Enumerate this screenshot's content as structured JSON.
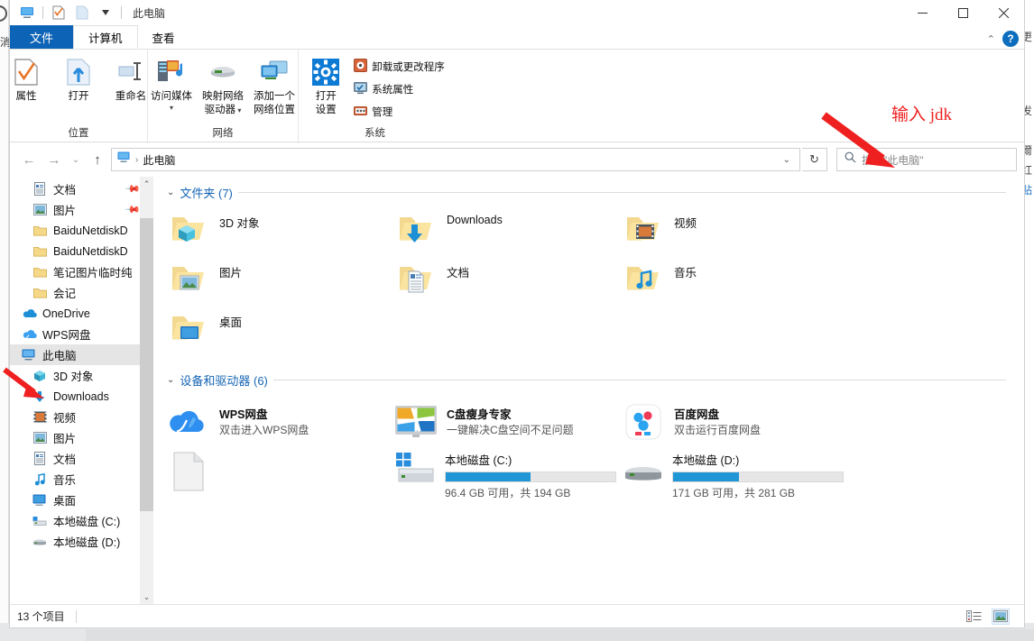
{
  "window": {
    "title": "此电脑",
    "quick_access": [
      "computer-icon",
      "properties-icon",
      "new-folder-icon",
      "dropdown-caret-icon"
    ],
    "controls": {
      "minimize": "—",
      "maximize": "□",
      "close": "✕"
    }
  },
  "tabs": [
    {
      "label": "文件",
      "kind": "file"
    },
    {
      "label": "计算机",
      "kind": "active"
    },
    {
      "label": "查看",
      "kind": "normal"
    }
  ],
  "tab_right": {
    "collapse": "⌃",
    "help": "?"
  },
  "ribbon": {
    "groups": [
      {
        "label": "位置",
        "big_buttons": [
          {
            "label": "属性",
            "icon": "properties-icon"
          },
          {
            "label": "打开",
            "icon": "open-icon"
          },
          {
            "label": "重命名",
            "icon": "rename-icon"
          }
        ],
        "small_buttons": []
      },
      {
        "label": "网络",
        "big_buttons": [
          {
            "label": "访问媒体",
            "label2": "",
            "icon": "media-server-icon",
            "has_caret": true
          },
          {
            "label": "映射网络",
            "label2": "驱动器",
            "icon": "map-drive-icon",
            "has_caret": true
          },
          {
            "label": "添加一个",
            "label2": "网络位置",
            "icon": "add-network-icon",
            "has_caret": false
          }
        ],
        "small_buttons": []
      },
      {
        "label": "系统",
        "big_buttons": [
          {
            "label": "打开",
            "label2": "设置",
            "icon": "settings-gear-icon"
          }
        ],
        "small_buttons": [
          {
            "label": "卸载或更改程序",
            "icon": "uninstall-icon"
          },
          {
            "label": "系统属性",
            "icon": "system-properties-icon"
          },
          {
            "label": "管理",
            "icon": "manage-icon"
          }
        ]
      }
    ]
  },
  "addressbar": {
    "back": "←",
    "forward": "→",
    "history": "⌄",
    "up": "↑",
    "breadcrumb_icon": "computer-icon",
    "breadcrumb": "此电脑",
    "breadcrumb_sep": "›",
    "dropdown": "⌄",
    "refresh": "↻"
  },
  "search": {
    "placeholder": "搜索\"此电脑\"",
    "icon": "search-icon"
  },
  "sidebar": {
    "items": [
      {
        "label": "文档",
        "icon": "documents-icon",
        "indent": 1,
        "pinned": true,
        "selected": false
      },
      {
        "label": "图片",
        "icon": "pictures-icon",
        "indent": 1,
        "pinned": true,
        "selected": false
      },
      {
        "label": "BaiduNetdiskD",
        "icon": "folder-icon",
        "indent": 1,
        "pinned": false,
        "selected": false
      },
      {
        "label": "BaiduNetdiskD",
        "icon": "folder-icon",
        "indent": 1,
        "pinned": false,
        "selected": false
      },
      {
        "label": "笔记图片临时纯",
        "icon": "folder-icon",
        "indent": 1,
        "pinned": false,
        "selected": false
      },
      {
        "label": "会记",
        "icon": "folder-icon",
        "indent": 1,
        "pinned": false,
        "selected": false
      },
      {
        "label": "OneDrive",
        "icon": "onedrive-icon",
        "indent": 0,
        "pinned": false,
        "selected": false
      },
      {
        "label": "WPS网盘",
        "icon": "wps-cloud-icon",
        "indent": 0,
        "pinned": false,
        "selected": false
      },
      {
        "label": "此电脑",
        "icon": "computer-icon",
        "indent": 0,
        "pinned": false,
        "selected": true
      },
      {
        "label": "3D 对象",
        "icon": "3d-objects-icon",
        "indent": 1,
        "pinned": false,
        "selected": false
      },
      {
        "label": "Downloads",
        "icon": "downloads-icon",
        "indent": 1,
        "pinned": false,
        "selected": false
      },
      {
        "label": "视频",
        "icon": "videos-icon",
        "indent": 1,
        "pinned": false,
        "selected": false
      },
      {
        "label": "图片",
        "icon": "pictures-icon",
        "indent": 1,
        "pinned": false,
        "selected": false
      },
      {
        "label": "文档",
        "icon": "documents-icon",
        "indent": 1,
        "pinned": false,
        "selected": false
      },
      {
        "label": "音乐",
        "icon": "music-icon",
        "indent": 1,
        "pinned": false,
        "selected": false
      },
      {
        "label": "桌面",
        "icon": "desktop-icon",
        "indent": 1,
        "pinned": false,
        "selected": false
      },
      {
        "label": "本地磁盘 (C:)",
        "icon": "drive-c-icon",
        "indent": 1,
        "pinned": false,
        "selected": false
      },
      {
        "label": "本地磁盘 (D:)",
        "icon": "drive-icon",
        "indent": 1,
        "pinned": false,
        "selected": false
      }
    ]
  },
  "content": {
    "folders_section": {
      "title": "文件夹 (7)",
      "chevron": "⌄",
      "items": [
        {
          "name": "3D 对象",
          "icon": "folder-3d-icon"
        },
        {
          "name": "Downloads",
          "icon": "folder-downloads-icon"
        },
        {
          "name": "视频",
          "icon": "folder-videos-icon"
        },
        {
          "name": "图片",
          "icon": "folder-pictures-icon"
        },
        {
          "name": "文档",
          "icon": "folder-documents-icon"
        },
        {
          "name": "音乐",
          "icon": "folder-music-icon"
        },
        {
          "name": "桌面",
          "icon": "folder-desktop-icon"
        }
      ]
    },
    "devices_section": {
      "title": "设备和驱动器 (6)",
      "chevron": "⌄",
      "items": [
        {
          "type": "app",
          "name": "WPS网盘",
          "sub": "双击进入WPS网盘",
          "icon": "wps-cloud-icon"
        },
        {
          "type": "app",
          "name": "C盘瘦身专家",
          "sub": "一键解决C盘空间不足问题",
          "icon": "disk-cleaner-icon"
        },
        {
          "type": "app",
          "name": "百度网盘",
          "sub": "双击运行百度网盘",
          "icon": "baidu-netdisk-icon"
        },
        {
          "type": "blank",
          "name": "",
          "sub": "",
          "icon": "blank-file-icon"
        },
        {
          "type": "drive",
          "name": "本地磁盘 (C:)",
          "free_text": "96.4 GB 可用，共 194 GB",
          "used_percent": 50,
          "icon": "drive-c-icon"
        },
        {
          "type": "drive",
          "name": "本地磁盘 (D:)",
          "free_text": "171 GB 可用，共 281 GB",
          "used_percent": 39,
          "icon": "drive-icon"
        }
      ]
    }
  },
  "statusbar": {
    "item_count": "13 个项目",
    "views": [
      {
        "icon": "details-view-icon",
        "active": false
      },
      {
        "icon": "large-icons-view-icon",
        "active": true
      }
    ]
  },
  "annotation": {
    "text": "输入 jdk",
    "color": "#ef2020",
    "arrows": [
      "arrow-to-search-box",
      "arrow-to-this-pc"
    ]
  },
  "background": {
    "left_fragment": "消",
    "right_fragments": [
      "更",
      "发",
      "爾",
      "红",
      "贴"
    ]
  }
}
